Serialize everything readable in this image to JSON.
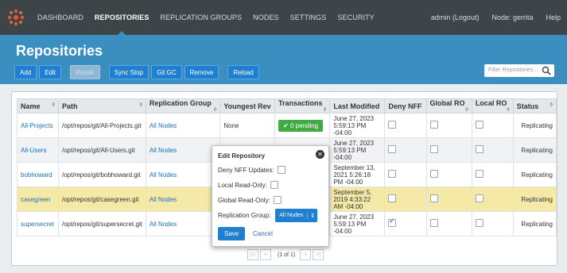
{
  "nav": {
    "items": [
      "DASHBOARD",
      "REPOSITORIES",
      "REPLICATION GROUPS",
      "NODES",
      "SETTINGS",
      "SECURITY"
    ],
    "active": 1,
    "user": "admin (Logout)",
    "node": "Node: gerrita",
    "help": "Help"
  },
  "header": {
    "title": "Repositories",
    "buttons": {
      "add": "Add",
      "edit": "Edit",
      "repair": "Repair",
      "sync_stop": "Sync Stop",
      "git_gc": "Git GC",
      "remove": "Remove",
      "reload": "Reload"
    },
    "filter_placeholder": "Filter Repositories..."
  },
  "table": {
    "columns": [
      "Name",
      "Path",
      "Replication Group",
      "Youngest Rev",
      "Transactions",
      "Last Modified",
      "Deny NFF",
      "Global RO",
      "Local RO",
      "Status"
    ],
    "rows": [
      {
        "name": "All-Projects",
        "path": "/opt/repos/git/All-Projects.git",
        "group": "All Nodes",
        "rev": "None",
        "tx": "0 pending",
        "modified": "June 27, 2023 5:59:13 PM -04:00",
        "deny_nff": false,
        "global_ro": false,
        "local_ro": false,
        "status": "Replicating"
      },
      {
        "name": "All-Users",
        "path": "/opt/repos/git/All-Users.git",
        "group": "All Nodes",
        "rev": "",
        "tx": "",
        "modified": "June 27, 2023 5:59:13 PM -04:00",
        "deny_nff": false,
        "global_ro": false,
        "local_ro": false,
        "status": "Replicating"
      },
      {
        "name": "bobhoward",
        "path": "/opt/repos/git/bobhoward.git",
        "group": "All Nodes",
        "rev": "",
        "tx": "",
        "modified": "September 13, 2021 5:26:18 PM -04:00",
        "deny_nff": false,
        "global_ro": false,
        "local_ro": false,
        "status": "Replicating"
      },
      {
        "name": "casegreen",
        "path": "/opt/repos/git/casegreen.git",
        "group": "All Nodes",
        "rev": "",
        "tx": "",
        "modified": "September 5, 2019 4:33:22 AM -04:00",
        "deny_nff": false,
        "global_ro": false,
        "local_ro": false,
        "status": "Replicating"
      },
      {
        "name": "supersecret",
        "path": "/opt/repos/git/supersecret.git",
        "group": "All Nodes",
        "rev": "",
        "tx": "",
        "modified": "June 27, 2023 5:59:13 PM -04:00",
        "deny_nff": true,
        "global_ro": false,
        "local_ro": false,
        "status": "Replicating"
      }
    ],
    "pager": "(1 of 1)"
  },
  "dialog": {
    "title": "Edit Repository",
    "deny_nff_label": "Deny NFF Updates:",
    "local_ro_label": "Local Read-Only:",
    "global_ro_label": "Global Read-Only:",
    "group_label": "Replication Group:",
    "group_value": "All Nodes",
    "save": "Save",
    "cancel": "Cancel"
  },
  "colors": {
    "topbar": "#3e4549",
    "accent": "#3a8fc0",
    "button": "#1f7fd0",
    "pending": "#3fab43",
    "selected_row": "#f5e9a8"
  }
}
